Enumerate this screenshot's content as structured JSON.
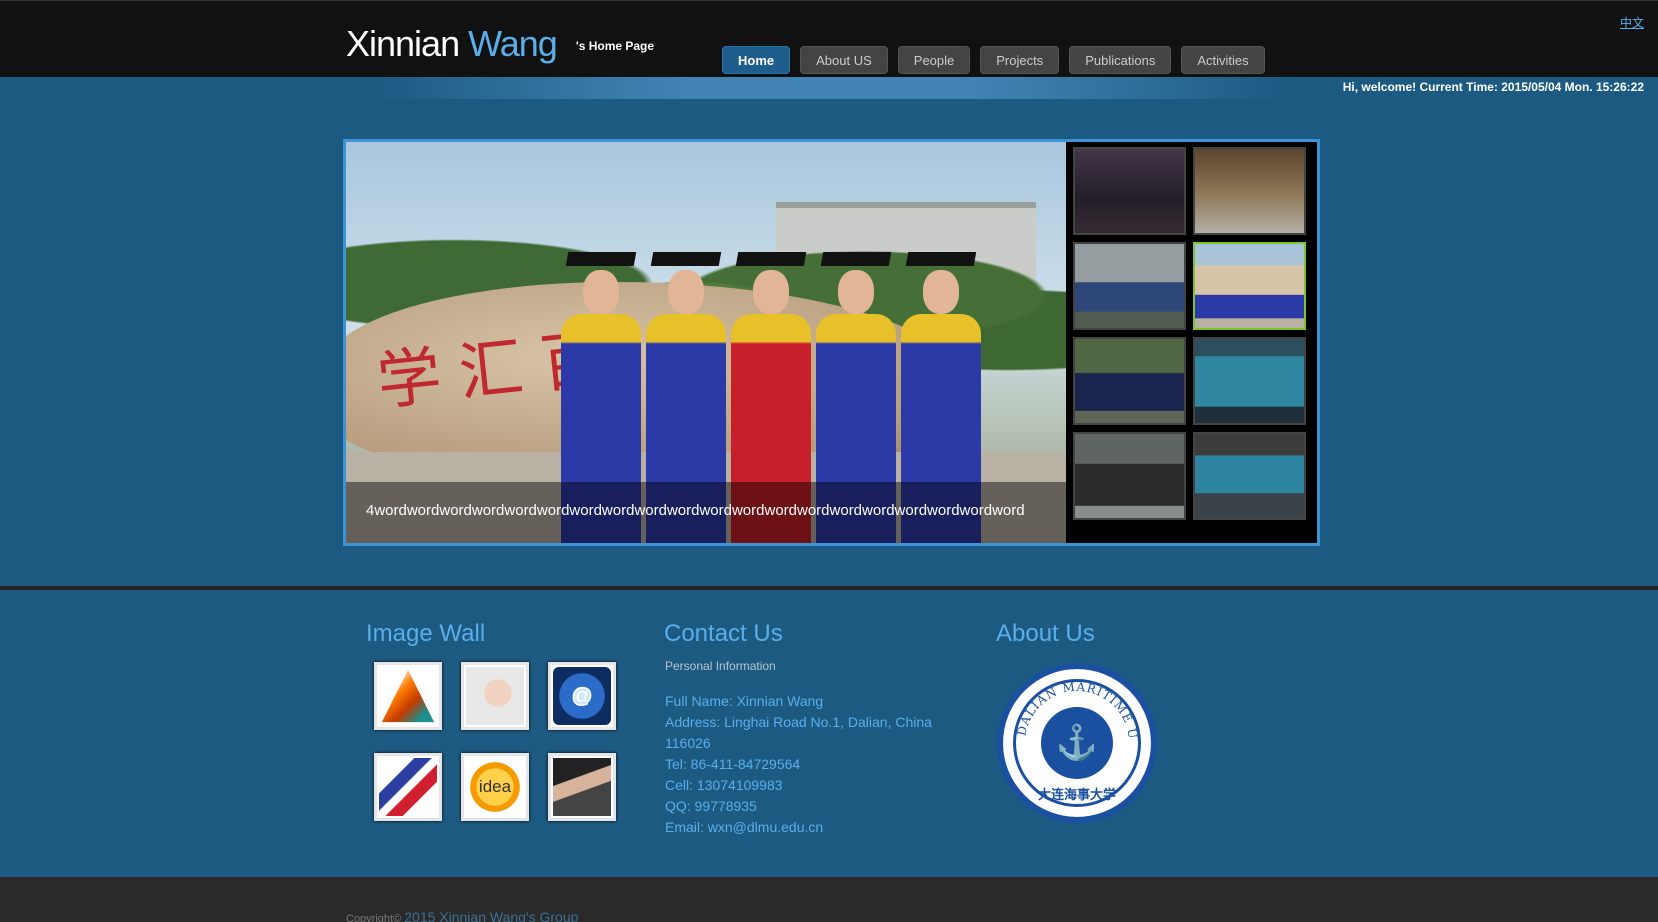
{
  "header": {
    "name_first": "Xinnian",
    "name_last": "Wang",
    "subtitle": "'s Home Page",
    "language_link": "中文"
  },
  "nav": {
    "items": [
      "Home",
      "About US",
      "People",
      "Projects",
      "Publications",
      "Activities"
    ],
    "active": "Home"
  },
  "welcome_text": "Hi, welcome! Current Time: 2015/05/04 Mon. 15:26:22",
  "slider": {
    "rock_inscription": "学汇百川",
    "caption": "4wordwordwordwordwordwordwordwordwordwordwordwordwordwordwordwordwordwordwordword",
    "thumbnail_count": 8,
    "active_thumbnail": 4
  },
  "image_wall": {
    "title": "Image Wall",
    "items": [
      "matlab-icon",
      "headset-icon",
      "at-icon",
      "chart-icon",
      "idea",
      "keyboard-icon"
    ],
    "idea_label": "idea",
    "at_symbol": "@"
  },
  "contact": {
    "title": "Contact Us",
    "section": "Personal Information",
    "full_name": "Full Name: Xinnian Wang",
    "address": "Address: Linghai Road No.1, Dalian, China 116026",
    "tel": "Tel: 86-411-84729564",
    "cell": "Cell: 13074109983",
    "qq": "QQ: 99778935",
    "email": "Email: wxn@dlmu.edu.cn"
  },
  "about": {
    "title": "About Us",
    "logo_text_en": "DALIAN MARITIME UNIVERSITY",
    "logo_text_cn": "大连海事大学"
  },
  "footer": {
    "copyright_prefix": "Copyright©",
    "group": "2015 Xinnian Wang's Group"
  },
  "colors": {
    "background": "#1d5a82",
    "accent": "#5aaeea",
    "topbar": "#111111",
    "active_thumb": "#7ec52b"
  }
}
